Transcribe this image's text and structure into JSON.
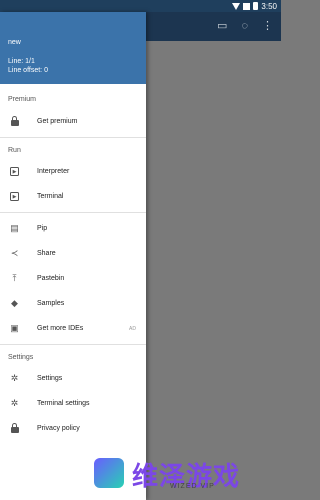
{
  "status_bar": {
    "time": "3:50"
  },
  "drawer": {
    "header": {
      "file_name": "new",
      "line": "Line: 1/1",
      "offset": "Line offset: 0"
    },
    "sections": {
      "premium": {
        "title": "Premium",
        "get_premium": "Get premium"
      },
      "run": {
        "title": "Run",
        "interpreter": "Interpreter",
        "terminal": "Terminal"
      },
      "misc": {
        "pip": "Pip",
        "share": "Share",
        "pastebin": "Pastebin",
        "samples": "Samples",
        "get_more_ides": "Get more IDEs",
        "ad_badge": "AD"
      },
      "settings": {
        "title": "Settings",
        "settings": "Settings",
        "terminal_settings": "Terminal settings",
        "privacy_policy": "Privacy policy"
      }
    }
  },
  "watermark": {
    "text": "维泽游戏",
    "sub": "WIZED VIP"
  },
  "colors": {
    "header": "#3b73aa",
    "app_bar": "#1c3550",
    "scrim": "#7a7a7a"
  }
}
